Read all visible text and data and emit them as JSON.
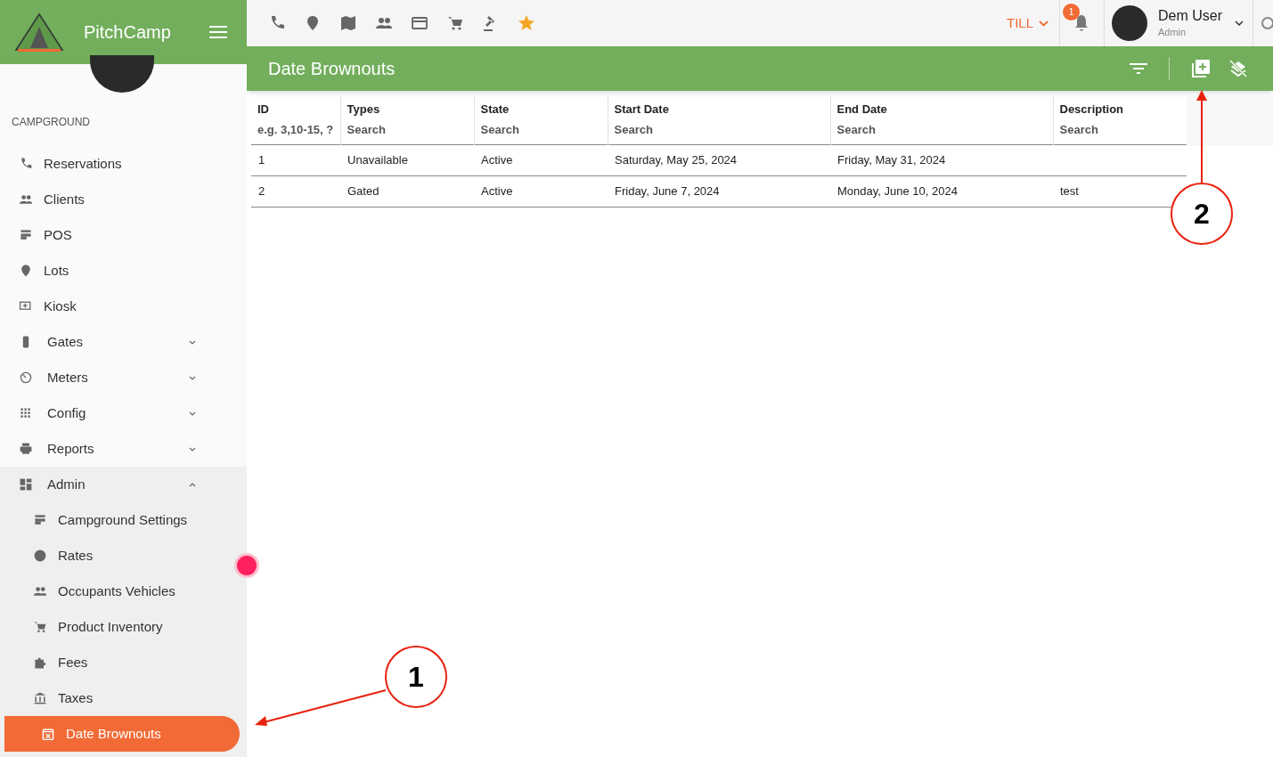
{
  "brand": {
    "name": "PitchCamp"
  },
  "sidebar": {
    "section": "CAMPGROUND",
    "items": [
      {
        "label": "Reservations",
        "kind": "link",
        "selected": false
      },
      {
        "label": "Clients",
        "kind": "link",
        "selected": false
      },
      {
        "label": "POS",
        "kind": "link",
        "selected": false
      },
      {
        "label": "Lots",
        "kind": "link",
        "selected": false
      },
      {
        "label": "Kiosk",
        "kind": "link",
        "selected": false
      },
      {
        "label": "Gates",
        "kind": "group",
        "expanded": false,
        "selected": false
      },
      {
        "label": "Meters",
        "kind": "group",
        "expanded": false,
        "selected": false
      },
      {
        "label": "Config",
        "kind": "group",
        "expanded": false,
        "selected": false
      },
      {
        "label": "Reports",
        "kind": "group",
        "expanded": false,
        "selected": false
      },
      {
        "label": "Admin",
        "kind": "group",
        "expanded": true,
        "selected": false,
        "children": [
          {
            "label": "Campground Settings",
            "selected": false
          },
          {
            "label": "Rates",
            "selected": false
          },
          {
            "label": "Occupants Vehicles",
            "selected": false
          },
          {
            "label": "Product Inventory",
            "selected": false
          },
          {
            "label": "Fees",
            "selected": false
          },
          {
            "label": "Taxes",
            "selected": false
          },
          {
            "label": "Date Brownouts",
            "selected": true
          }
        ]
      }
    ]
  },
  "topbar": {
    "till": "TILL",
    "notifications": "1",
    "user": {
      "name": "Dem User",
      "role": "Admin"
    }
  },
  "page": {
    "title": "Date Brownouts"
  },
  "table": {
    "columns": [
      {
        "label": "ID",
        "placeholder": "e.g. 3,10-15, ?"
      },
      {
        "label": "Types",
        "placeholder": "Search"
      },
      {
        "label": "State",
        "placeholder": "Search"
      },
      {
        "label": "Start Date",
        "placeholder": "Search"
      },
      {
        "label": "End Date",
        "placeholder": "Search"
      },
      {
        "label": "Description",
        "placeholder": "Search"
      }
    ],
    "rows": [
      [
        "1",
        "Unavailable",
        "Active",
        "Saturday, May 25, 2024",
        "Friday, May 31, 2024",
        ""
      ],
      [
        "2",
        "Gated",
        "Active",
        "Friday, June 7, 2024",
        "Monday, June 10, 2024",
        "test"
      ]
    ]
  },
  "annotations": [
    {
      "label": "1"
    },
    {
      "label": "2"
    }
  ]
}
